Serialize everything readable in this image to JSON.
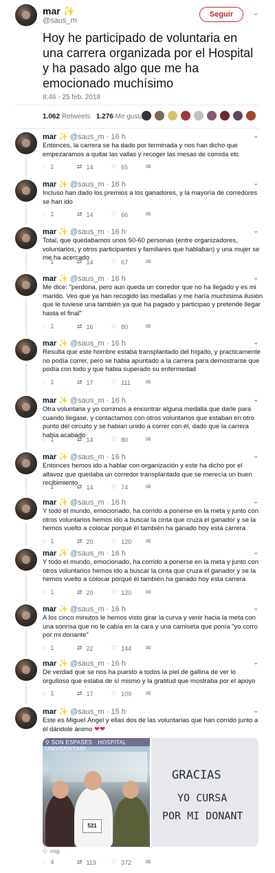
{
  "main": {
    "name": "mar",
    "sparkle": "✨",
    "handle": "@saus_m",
    "follow_label": "Seguir",
    "text": "Hoy he participado de voluntaria en una carrera organizada por el Hospital y ha pasado algo que me ha emocionado muchísimo",
    "time": "8:46 - 25 feb. 2018",
    "retweets_count": "1.062",
    "retweets_label": "Retweets",
    "likes_count": "1.276",
    "likes_label": "Me gusta"
  },
  "replies": [
    {
      "meta": "@saus_m · 16 h",
      "text": "Entonces, la carrera se ha dado por terminada y nos han dicho que empezaramos a quitar las vallas y recoger las mesas de comida etc",
      "replies": "1",
      "retweets": "14",
      "likes": "65"
    },
    {
      "meta": "@saus_m · 16 h",
      "text": "Incluso han dado los premios a los ganadores, y la mayoría de corredores se han ido",
      "replies": "1",
      "retweets": "14",
      "likes": "66"
    },
    {
      "meta": "@saus_m · 16 h",
      "text": "Total, que quedabamos unos 50-60 personas (entre organizadores, voluntarios, y otros participantes y familiares que hablaban) y una mujer se me ha acercado",
      "replies": "1",
      "retweets": "14",
      "likes": "67"
    },
    {
      "meta": "@saus_m · 16 h",
      "text": "Me dice: \"perdona, pero aun queda un corredor que no ha llegado y es mi marido. Veo que ya han recogido las medallas y me haría muchisima ilusión que le tuviese una también ya que ha pagado y participao y pretende llegar hasta el final\"",
      "replies": "1",
      "retweets": "16",
      "likes": "80"
    },
    {
      "meta": "@saus_m · 16 h",
      "text": "Resulta que este hombre estaba transplantado del hígado, y practicamente no podía correr, pero se habia apuntado a la carrera para demostrarse que podía con todo y que habia superado su enfermedad",
      "replies": "1",
      "retweets": "17",
      "likes": "111"
    },
    {
      "meta": "@saus_m · 16 h",
      "text": "Otra voluntaria y yo corrimos a encontrar alguna medalla que darle para cuando llegase, y contactamos con otros voluntarios que estaban en otro punto del circuito y se habian unido a correr con él, dado que la carrera habia acabado",
      "replies": "1",
      "retweets": "14",
      "likes": "80"
    },
    {
      "meta": "@saus_m · 16 h",
      "text": "Entonces hemos ido a hablar con organización y este ha dicho por el altavoz que quedaba un corredor transplantado que se merecía un buen recibimiento",
      "replies": "1",
      "retweets": "14",
      "likes": "74"
    },
    {
      "meta": "@saus_m · 16 h",
      "text": "Y todo el mundo, emocionado, ha corrido a ponerse en la meta y junto con otros voluntarios hemos ido a buscar la cinta que cruza el ganador y se la hemos vuelto a colocar porqué él también ha ganado hoy esta carrera",
      "replies": "1",
      "retweets": "20",
      "likes": "120"
    },
    {
      "meta": "@saus_m · 16 h",
      "text": "Y todo el mundo, emocionado, ha corrido a ponerse en la meta y junto con otros voluntarios hemos ido a buscar la cinta que cruza el ganador y se la hemos vuelto a colocar porqué él también ha ganado hoy esta carrera",
      "replies": "1",
      "retweets": "20",
      "likes": "120"
    },
    {
      "meta": "@saus_m · 16 h",
      "text": "A los cinco minutos le hemos visto girar la curva y venir hacia la meta con una sonrisa que no le cabía en la cara y una camiseta que ponía \"yo corro por mi donante\"",
      "replies": "1",
      "retweets": "22",
      "likes": "144"
    },
    {
      "meta": "@saus_m · 16 h",
      "text": "De verdad que se nos ha puesto a todos la piel de gallina de ver lo orgulloso que estaba de sí mismo y la gratitud que mostraba por el apoyo",
      "replies": "1",
      "retweets": "17",
      "likes": "109"
    },
    {
      "meta": "@saus_m · 15 h",
      "text": "Este es Miguel Ángel y ellas dos de las voluntarias que han corrido junto a él dándole ánimo ❤️❤️",
      "replies": "4",
      "retweets": "119",
      "likes": "372"
    }
  ],
  "photo": {
    "location": "SON ESPASES · HOSPITAL UNIVERSITARI",
    "bib": "531",
    "sign_line1": "GRACIAS",
    "sign_line2": "YO CURSA",
    "sign_line3": "POR MI DONANT"
  },
  "caption": "roig",
  "colors": {
    "follow": "#c1272d",
    "muted": "#657786",
    "heart": "#e0245e",
    "divider": "#e6ecf0"
  }
}
